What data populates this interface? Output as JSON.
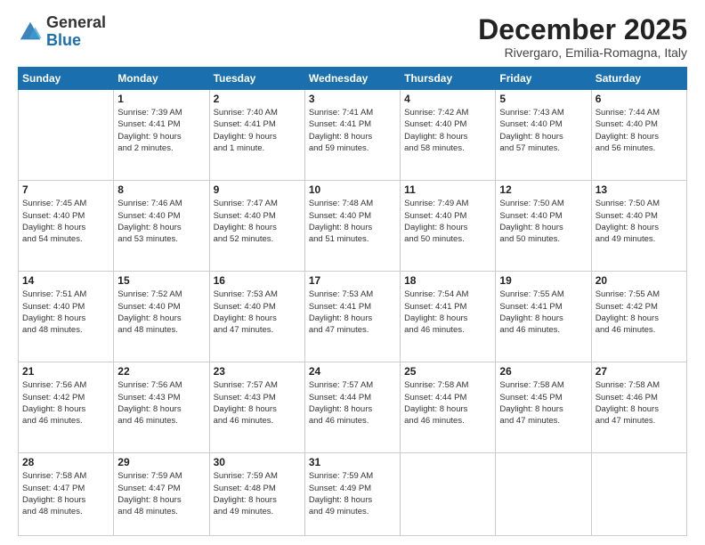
{
  "logo": {
    "general": "General",
    "blue": "Blue"
  },
  "header": {
    "month": "December 2025",
    "location": "Rivergaro, Emilia-Romagna, Italy"
  },
  "days_header": [
    "Sunday",
    "Monday",
    "Tuesday",
    "Wednesday",
    "Thursday",
    "Friday",
    "Saturday"
  ],
  "weeks": [
    [
      {
        "day": "",
        "info": ""
      },
      {
        "day": "1",
        "info": "Sunrise: 7:39 AM\nSunset: 4:41 PM\nDaylight: 9 hours\nand 2 minutes."
      },
      {
        "day": "2",
        "info": "Sunrise: 7:40 AM\nSunset: 4:41 PM\nDaylight: 9 hours\nand 1 minute."
      },
      {
        "day": "3",
        "info": "Sunrise: 7:41 AM\nSunset: 4:41 PM\nDaylight: 8 hours\nand 59 minutes."
      },
      {
        "day": "4",
        "info": "Sunrise: 7:42 AM\nSunset: 4:40 PM\nDaylight: 8 hours\nand 58 minutes."
      },
      {
        "day": "5",
        "info": "Sunrise: 7:43 AM\nSunset: 4:40 PM\nDaylight: 8 hours\nand 57 minutes."
      },
      {
        "day": "6",
        "info": "Sunrise: 7:44 AM\nSunset: 4:40 PM\nDaylight: 8 hours\nand 56 minutes."
      }
    ],
    [
      {
        "day": "7",
        "info": "Sunrise: 7:45 AM\nSunset: 4:40 PM\nDaylight: 8 hours\nand 54 minutes."
      },
      {
        "day": "8",
        "info": "Sunrise: 7:46 AM\nSunset: 4:40 PM\nDaylight: 8 hours\nand 53 minutes."
      },
      {
        "day": "9",
        "info": "Sunrise: 7:47 AM\nSunset: 4:40 PM\nDaylight: 8 hours\nand 52 minutes."
      },
      {
        "day": "10",
        "info": "Sunrise: 7:48 AM\nSunset: 4:40 PM\nDaylight: 8 hours\nand 51 minutes."
      },
      {
        "day": "11",
        "info": "Sunrise: 7:49 AM\nSunset: 4:40 PM\nDaylight: 8 hours\nand 50 minutes."
      },
      {
        "day": "12",
        "info": "Sunrise: 7:50 AM\nSunset: 4:40 PM\nDaylight: 8 hours\nand 50 minutes."
      },
      {
        "day": "13",
        "info": "Sunrise: 7:50 AM\nSunset: 4:40 PM\nDaylight: 8 hours\nand 49 minutes."
      }
    ],
    [
      {
        "day": "14",
        "info": "Sunrise: 7:51 AM\nSunset: 4:40 PM\nDaylight: 8 hours\nand 48 minutes."
      },
      {
        "day": "15",
        "info": "Sunrise: 7:52 AM\nSunset: 4:40 PM\nDaylight: 8 hours\nand 48 minutes."
      },
      {
        "day": "16",
        "info": "Sunrise: 7:53 AM\nSunset: 4:40 PM\nDaylight: 8 hours\nand 47 minutes."
      },
      {
        "day": "17",
        "info": "Sunrise: 7:53 AM\nSunset: 4:41 PM\nDaylight: 8 hours\nand 47 minutes."
      },
      {
        "day": "18",
        "info": "Sunrise: 7:54 AM\nSunset: 4:41 PM\nDaylight: 8 hours\nand 46 minutes."
      },
      {
        "day": "19",
        "info": "Sunrise: 7:55 AM\nSunset: 4:41 PM\nDaylight: 8 hours\nand 46 minutes."
      },
      {
        "day": "20",
        "info": "Sunrise: 7:55 AM\nSunset: 4:42 PM\nDaylight: 8 hours\nand 46 minutes."
      }
    ],
    [
      {
        "day": "21",
        "info": "Sunrise: 7:56 AM\nSunset: 4:42 PM\nDaylight: 8 hours\nand 46 minutes."
      },
      {
        "day": "22",
        "info": "Sunrise: 7:56 AM\nSunset: 4:43 PM\nDaylight: 8 hours\nand 46 minutes."
      },
      {
        "day": "23",
        "info": "Sunrise: 7:57 AM\nSunset: 4:43 PM\nDaylight: 8 hours\nand 46 minutes."
      },
      {
        "day": "24",
        "info": "Sunrise: 7:57 AM\nSunset: 4:44 PM\nDaylight: 8 hours\nand 46 minutes."
      },
      {
        "day": "25",
        "info": "Sunrise: 7:58 AM\nSunset: 4:44 PM\nDaylight: 8 hours\nand 46 minutes."
      },
      {
        "day": "26",
        "info": "Sunrise: 7:58 AM\nSunset: 4:45 PM\nDaylight: 8 hours\nand 47 minutes."
      },
      {
        "day": "27",
        "info": "Sunrise: 7:58 AM\nSunset: 4:46 PM\nDaylight: 8 hours\nand 47 minutes."
      }
    ],
    [
      {
        "day": "28",
        "info": "Sunrise: 7:58 AM\nSunset: 4:47 PM\nDaylight: 8 hours\nand 48 minutes."
      },
      {
        "day": "29",
        "info": "Sunrise: 7:59 AM\nSunset: 4:47 PM\nDaylight: 8 hours\nand 48 minutes."
      },
      {
        "day": "30",
        "info": "Sunrise: 7:59 AM\nSunset: 4:48 PM\nDaylight: 8 hours\nand 49 minutes."
      },
      {
        "day": "31",
        "info": "Sunrise: 7:59 AM\nSunset: 4:49 PM\nDaylight: 8 hours\nand 49 minutes."
      },
      {
        "day": "",
        "info": ""
      },
      {
        "day": "",
        "info": ""
      },
      {
        "day": "",
        "info": ""
      }
    ]
  ]
}
